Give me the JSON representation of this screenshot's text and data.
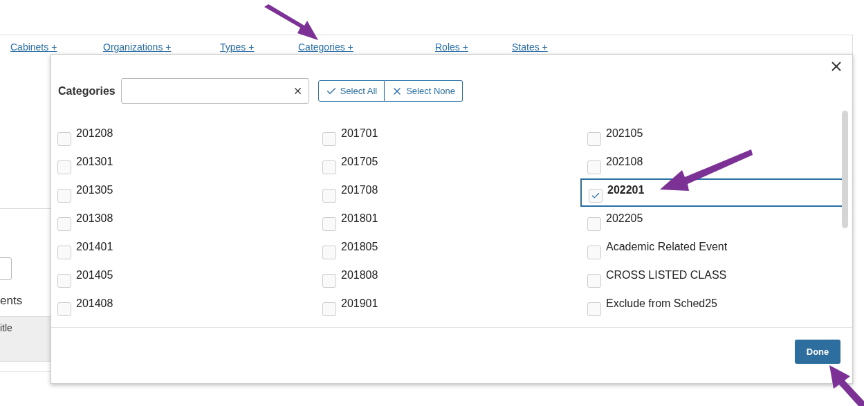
{
  "filters": [
    {
      "label": "Cabinets +"
    },
    {
      "label": "Organizations +"
    },
    {
      "label": "Types +"
    },
    {
      "label": "Categories +"
    },
    {
      "label": "Roles +"
    },
    {
      "label": "States +"
    }
  ],
  "background": {
    "section_label": "ents",
    "column_header": "itle"
  },
  "dialog": {
    "title": "Categories",
    "select_all": "Select All",
    "select_none": "Select None",
    "done": "Done",
    "columns": [
      [
        {
          "label": "201208",
          "checked": false,
          "selected": false
        },
        {
          "label": "201301",
          "checked": false,
          "selected": false
        },
        {
          "label": "201305",
          "checked": false,
          "selected": false
        },
        {
          "label": "201308",
          "checked": false,
          "selected": false
        },
        {
          "label": "201401",
          "checked": false,
          "selected": false
        },
        {
          "label": "201405",
          "checked": false,
          "selected": false
        },
        {
          "label": "201408",
          "checked": false,
          "selected": false
        }
      ],
      [
        {
          "label": "201701",
          "checked": false,
          "selected": false
        },
        {
          "label": "201705",
          "checked": false,
          "selected": false
        },
        {
          "label": "201708",
          "checked": false,
          "selected": false
        },
        {
          "label": "201801",
          "checked": false,
          "selected": false
        },
        {
          "label": "201805",
          "checked": false,
          "selected": false
        },
        {
          "label": "201808",
          "checked": false,
          "selected": false
        },
        {
          "label": "201901",
          "checked": false,
          "selected": false
        }
      ],
      [
        {
          "label": "202105",
          "checked": false,
          "selected": false
        },
        {
          "label": "202108",
          "checked": false,
          "selected": false
        },
        {
          "label": "202201",
          "checked": true,
          "selected": true
        },
        {
          "label": "202205",
          "checked": false,
          "selected": false
        },
        {
          "label": "Academic Related Event",
          "checked": false,
          "selected": false
        },
        {
          "label": "CROSS LISTED CLASS",
          "checked": false,
          "selected": false
        },
        {
          "label": "Exclude from Sched25",
          "checked": false,
          "selected": false
        }
      ]
    ]
  }
}
